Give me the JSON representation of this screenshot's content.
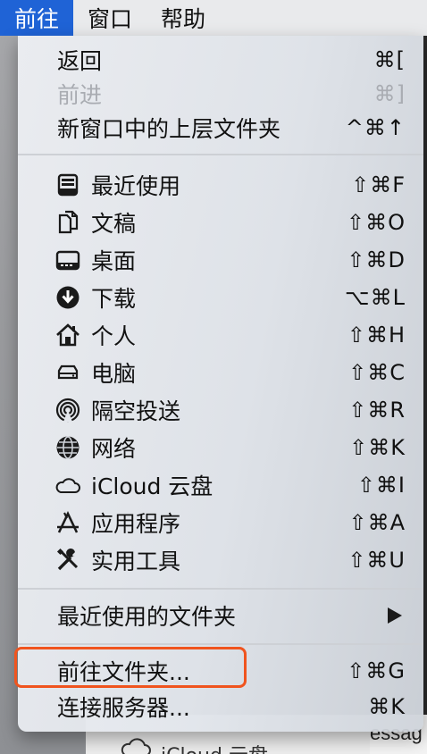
{
  "menubar": {
    "items": [
      {
        "label": "前往",
        "active": true
      },
      {
        "label": "窗口",
        "active": false
      },
      {
        "label": "帮助",
        "active": false
      }
    ]
  },
  "menu": {
    "group1": [
      {
        "label": "返回",
        "shortcut": "⌘[",
        "disabled": false
      },
      {
        "label": "前进",
        "shortcut": "⌘]",
        "disabled": true
      },
      {
        "label": "新窗口中的上层文件夹",
        "shortcut": "^⌘↑",
        "disabled": false
      }
    ],
    "group2": [
      {
        "label": "最近使用",
        "shortcut": "⇧⌘F",
        "icon": "recents-icon"
      },
      {
        "label": "文稿",
        "shortcut": "⇧⌘O",
        "icon": "documents-icon"
      },
      {
        "label": "桌面",
        "shortcut": "⇧⌘D",
        "icon": "desktop-icon"
      },
      {
        "label": "下载",
        "shortcut": "⌥⌘L",
        "icon": "download-icon"
      },
      {
        "label": "个人",
        "shortcut": "⇧⌘H",
        "icon": "home-icon"
      },
      {
        "label": "电脑",
        "shortcut": "⇧⌘C",
        "icon": "computer-icon"
      },
      {
        "label": "隔空投送",
        "shortcut": "⇧⌘R",
        "icon": "airdrop-icon"
      },
      {
        "label": "网络",
        "shortcut": "⇧⌘K",
        "icon": "network-icon"
      },
      {
        "label": "iCloud 云盘",
        "shortcut": "⇧⌘I",
        "icon": "icloud-icon"
      },
      {
        "label": "应用程序",
        "shortcut": "⇧⌘A",
        "icon": "applications-icon"
      },
      {
        "label": "实用工具",
        "shortcut": "⇧⌘U",
        "icon": "utilities-icon"
      }
    ],
    "group3": [
      {
        "label": "最近使用的文件夹",
        "submenu": true
      }
    ],
    "group4": [
      {
        "label": "前往文件夹...",
        "shortcut": "⇧⌘G"
      },
      {
        "label": "连接服务器...",
        "shortcut": "⌘K"
      }
    ]
  },
  "background": {
    "window_text": "iCloud 云盘",
    "right_text": "essag"
  },
  "colors": {
    "accent": "#1f63d6",
    "highlight_border": "#f0541e",
    "disabled_text": "#a9acb2"
  }
}
